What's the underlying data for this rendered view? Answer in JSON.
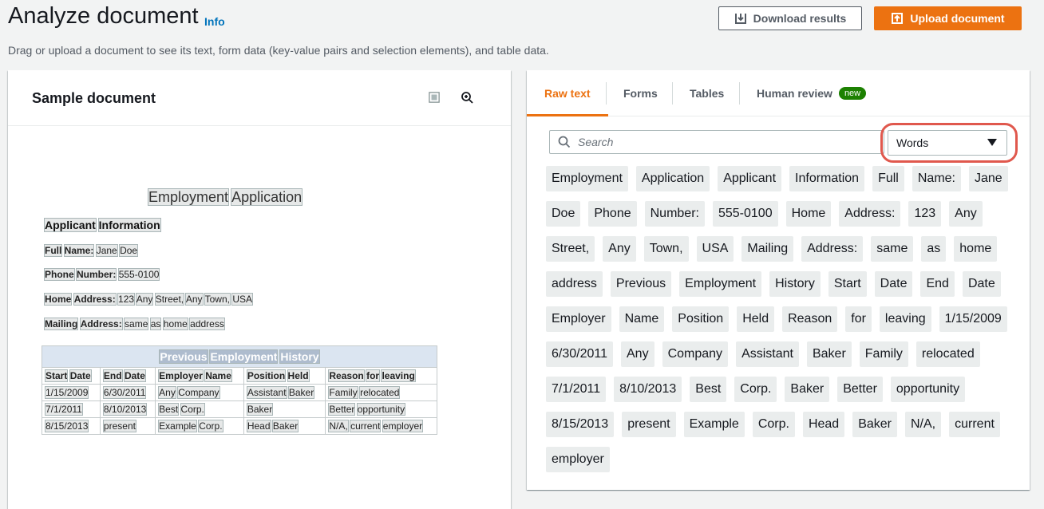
{
  "header": {
    "title": "Analyze document",
    "info": "Info",
    "subtitle": "Drag or upload a document to see its text, form data (key-value pairs and selection elements), and table data.",
    "download_label": "Download results",
    "upload_label": "Upload document"
  },
  "left": {
    "title": "Sample document",
    "icons": [
      "pages-icon",
      "zoom-in-icon"
    ]
  },
  "document": {
    "title_words": [
      "Employment",
      "Application"
    ],
    "section_words": [
      "Applicant",
      "Information"
    ],
    "lines": [
      {
        "label": [
          "Full",
          "Name:"
        ],
        "value": [
          "Jane",
          "Doe"
        ]
      },
      {
        "label": [
          "Phone",
          "Number:"
        ],
        "value": [
          "555-0100"
        ]
      },
      {
        "label": [
          "Home",
          "Address:"
        ],
        "value": [
          "123",
          "Any",
          "Street,",
          "Any",
          "Town,",
          "USA"
        ]
      },
      {
        "label": [
          "Mailing",
          "Address:"
        ],
        "value": [
          "same",
          "as",
          "home",
          "address"
        ]
      }
    ],
    "table_caption": [
      "Previous",
      "Employment",
      "History"
    ],
    "table_headers": [
      [
        "Start",
        "Date"
      ],
      [
        "End",
        "Date"
      ],
      [
        "Employer",
        "Name"
      ],
      [
        "Position",
        "Held"
      ],
      [
        "Reason",
        "for",
        "leaving"
      ]
    ],
    "table_rows": [
      [
        [
          "1/15/2009"
        ],
        [
          "6/30/2011"
        ],
        [
          "Any",
          "Company"
        ],
        [
          "Assistant",
          "Baker"
        ],
        [
          "Family",
          "relocated"
        ]
      ],
      [
        [
          "7/1/2011"
        ],
        [
          "8/10/2013"
        ],
        [
          "Best",
          "Corp."
        ],
        [
          "Baker"
        ],
        [
          "Better",
          "opportunity"
        ]
      ],
      [
        [
          "8/15/2013"
        ],
        [
          "present"
        ],
        [
          "Example",
          "Corp."
        ],
        [
          "Head",
          "Baker"
        ],
        [
          "N/A,",
          "current",
          "employer"
        ]
      ]
    ]
  },
  "right": {
    "tabs": [
      {
        "label": "Raw text",
        "active": true
      },
      {
        "label": "Forms",
        "active": false
      },
      {
        "label": "Tables",
        "active": false
      },
      {
        "label": "Human review",
        "active": false,
        "badge": "new"
      }
    ],
    "search_placeholder": "Search",
    "search_value": "",
    "select_value": "Words",
    "words": [
      "Employment",
      "Application",
      "Applicant",
      "Information",
      "Full",
      "Name:",
      "Jane",
      "Doe",
      "Phone",
      "Number:",
      "555-0100",
      "Home",
      "Address:",
      "123",
      "Any",
      "Street,",
      "Any",
      "Town,",
      "USA",
      "Mailing",
      "Address:",
      "same",
      "as",
      "home",
      "address",
      "Previous",
      "Employment",
      "History",
      "Start",
      "Date",
      "End",
      "Date",
      "Employer",
      "Name",
      "Position",
      "Held",
      "Reason",
      "for",
      "leaving",
      "1/15/2009",
      "6/30/2011",
      "Any",
      "Company",
      "Assistant",
      "Baker",
      "Family",
      "relocated",
      "7/1/2011",
      "8/10/2013",
      "Best",
      "Corp.",
      "Baker",
      "Better",
      "opportunity",
      "8/15/2013",
      "present",
      "Example",
      "Corp.",
      "Head",
      "Baker",
      "N/A,",
      "current",
      "employer"
    ]
  },
  "colors": {
    "accent": "#ec7211",
    "link": "#0073bb",
    "badge": "#1d8102",
    "highlight_ring": "#e0584d"
  }
}
